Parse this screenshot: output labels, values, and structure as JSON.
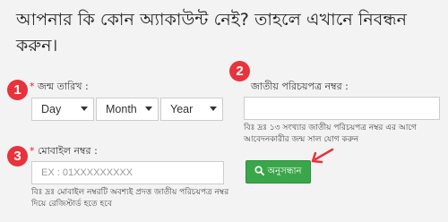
{
  "heading": "আপনার কি কোন অ্যাকাউন্ট নেই? তাহলে এখানে নিবন্ধন করুন।",
  "markers": [
    "1",
    "2",
    "3"
  ],
  "birth_date": {
    "label": "জন্ম তারিখ :",
    "required_mark": "*",
    "day": "Day",
    "month": "Month",
    "year": "Year"
  },
  "nid": {
    "label": "জাতীয় পরিচয়পত্র নম্বর :",
    "value": "",
    "help": "বিঃ দ্রঃ ১৩ সংখ্যার জাতীয় পরিচয়পত্র নম্বর এর আগে আবেদনকারীর জন্ম সাল যোগ করুন"
  },
  "mobile": {
    "label": "মোবাইল নম্বর :",
    "required_mark": "*",
    "placeholder": "EX : 01XXXXXXXXX",
    "help": "বিঃ দ্রঃ মোবাইল নম্বরটি অবশ্যই প্রদত্ত জাতীয় পরিচয়পত্র নম্বর দিয়ে রেজিস্টার্ড হতে হবে"
  },
  "search_button": {
    "label": "অনুসন্ধান",
    "icon": "search-icon"
  },
  "colors": {
    "marker": "#e8323c",
    "button": "#3aa64a",
    "required": "#d9232d",
    "background": "#f3f3f3"
  }
}
